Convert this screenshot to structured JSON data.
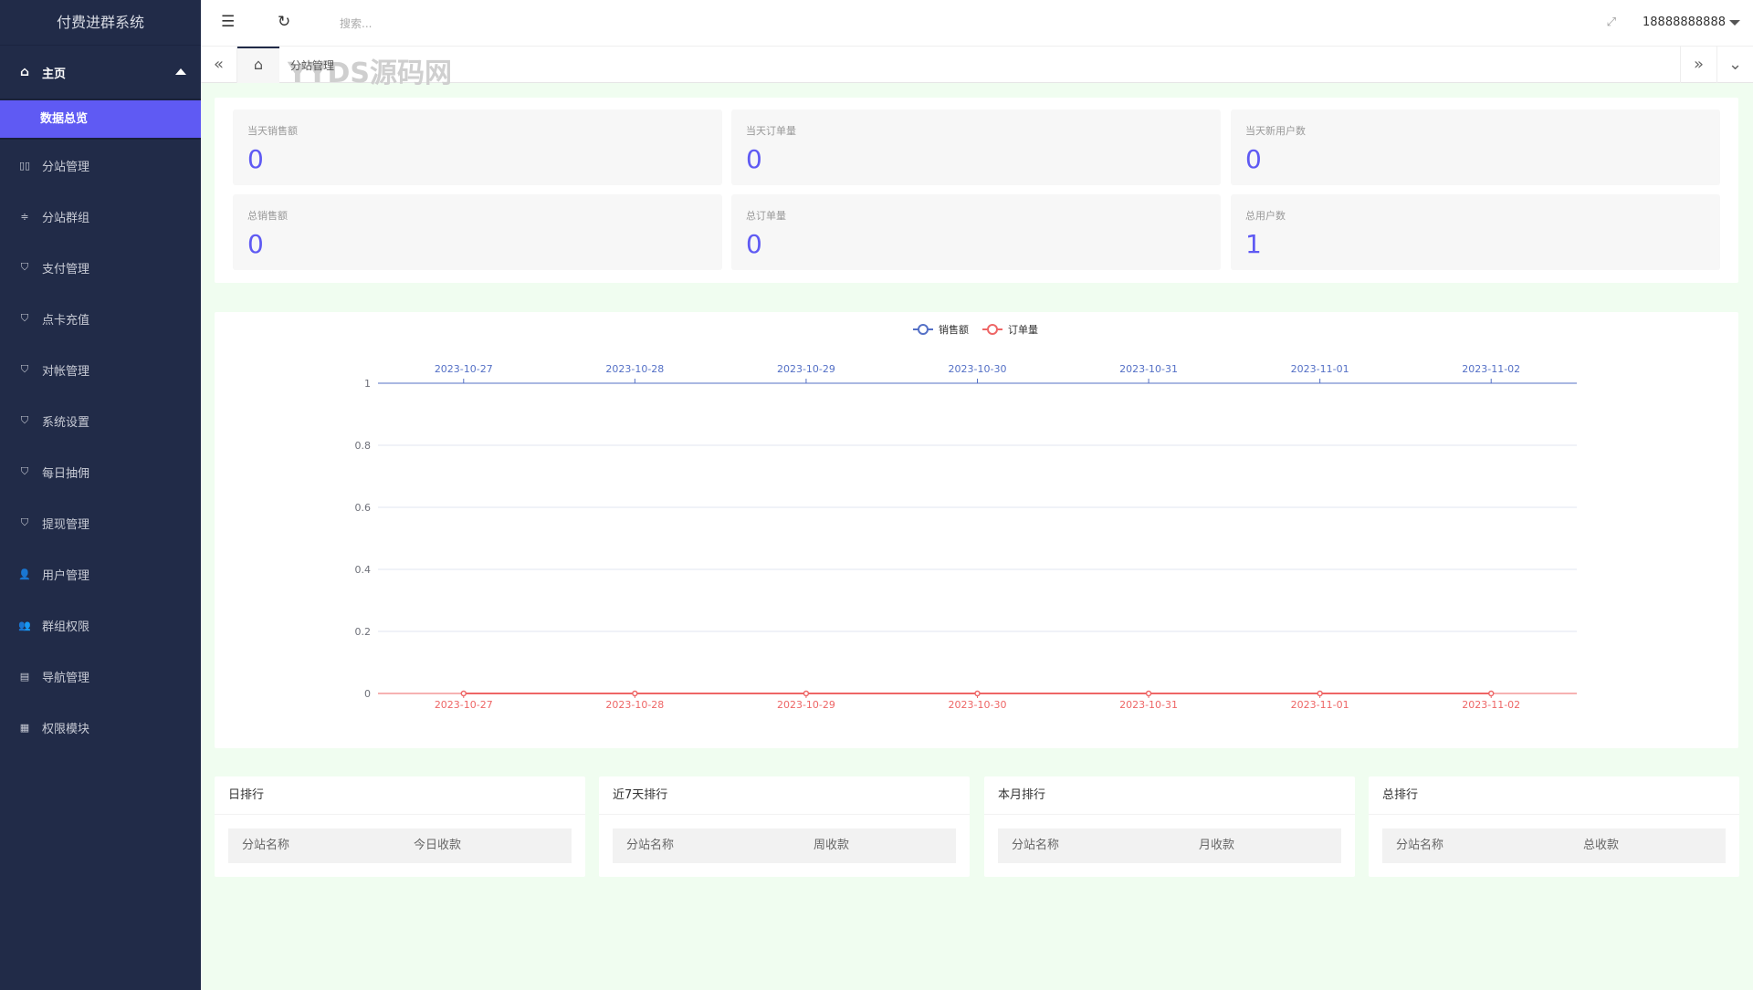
{
  "app": {
    "title": "付费进群系统"
  },
  "sidebar": {
    "home": "主页",
    "active_sub": "数据总览",
    "items": [
      {
        "label": "分站管理",
        "icon": "columns-icon"
      },
      {
        "label": "分站群组",
        "icon": "sliders-icon"
      },
      {
        "label": "支付管理",
        "icon": "shield-check-icon"
      },
      {
        "label": "点卡充值",
        "icon": "shield-check-icon"
      },
      {
        "label": "对帐管理",
        "icon": "shield-check-icon"
      },
      {
        "label": "系统设置",
        "icon": "shield-check-icon"
      },
      {
        "label": "每日抽佣",
        "icon": "shield-check-icon"
      },
      {
        "label": "提现管理",
        "icon": "shield-check-icon"
      },
      {
        "label": "用户管理",
        "icon": "user-icon"
      },
      {
        "label": "群组权限",
        "icon": "users-icon"
      },
      {
        "label": "导航管理",
        "icon": "nav-icon"
      },
      {
        "label": "权限模块",
        "icon": "grid-icon"
      }
    ]
  },
  "header": {
    "search_placeholder": "搜索...",
    "user": "18888888888"
  },
  "tabs": {
    "current": "分站管理",
    "watermark": "YYDS源码网"
  },
  "stats": [
    {
      "label": "当天销售额",
      "value": "0"
    },
    {
      "label": "当天订单量",
      "value": "0"
    },
    {
      "label": "当天新用户数",
      "value": "0"
    },
    {
      "label": "总销售额",
      "value": "0"
    },
    {
      "label": "总订单量",
      "value": "0"
    },
    {
      "label": "总用户数",
      "value": "1"
    }
  ],
  "chart_data": {
    "type": "line",
    "categories": [
      "2023-10-27",
      "2023-10-28",
      "2023-10-29",
      "2023-10-30",
      "2023-10-31",
      "2023-11-01",
      "2023-11-02"
    ],
    "series": [
      {
        "name": "销售额",
        "values": [
          0,
          0,
          0,
          0,
          0,
          0,
          0
        ],
        "color": "#5470c6",
        "x_axis": "top"
      },
      {
        "name": "订单量",
        "values": [
          0,
          0,
          0,
          0,
          0,
          0,
          0
        ],
        "color": "#ee6666",
        "x_axis": "bottom"
      }
    ],
    "ylim": [
      0,
      1
    ],
    "yticks": [
      "0",
      "0.2",
      "0.4",
      "0.6",
      "0.8",
      "1"
    ],
    "grid": true,
    "legend": "top-center"
  },
  "rankings": [
    {
      "title": "日排行",
      "col1": "分站名称",
      "col2": "今日收款"
    },
    {
      "title": "近7天排行",
      "col1": "分站名称",
      "col2": "周收款"
    },
    {
      "title": "本月排行",
      "col1": "分站名称",
      "col2": "月收款"
    },
    {
      "title": "总排行",
      "col1": "分站名称",
      "col2": "总收款"
    }
  ]
}
